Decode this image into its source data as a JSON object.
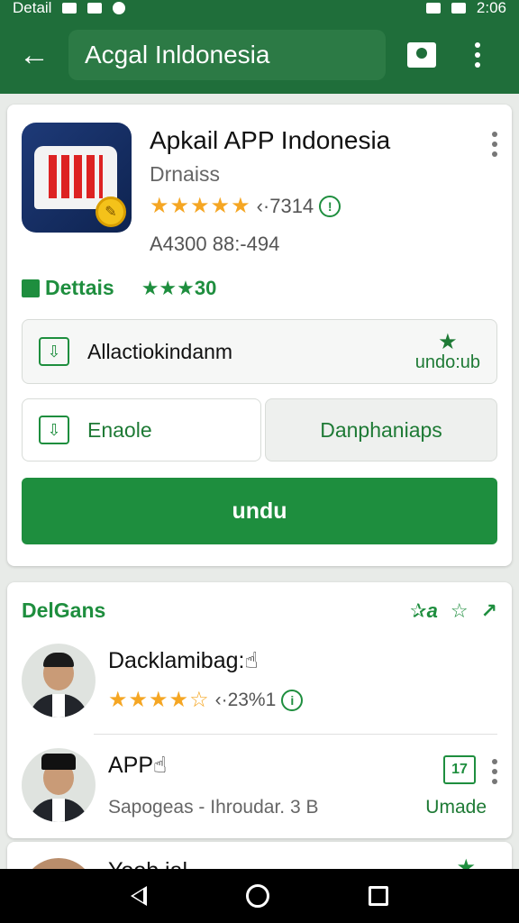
{
  "status_bar": {
    "left_text": "Detail",
    "time": "2:06"
  },
  "app_bar": {
    "back_icon": "arrow-left-icon",
    "search_text": "Acgal Inldonesia",
    "bookmark_icon": "bookmark-icon",
    "menu_icon": "more-vert-icon"
  },
  "app": {
    "title": "Apkail APP Indonesia",
    "developer": "Drnaiss",
    "stars": "★★★★★",
    "rating_count": "‹·7314",
    "info_glyph": "!",
    "meta": "A4300 88:-494"
  },
  "details": {
    "label": "Dettais",
    "rating": "★★★30"
  },
  "row_wide": {
    "label": "Allactiokindanm",
    "action_label": "undo:ub",
    "action_icon": "★"
  },
  "row_left": {
    "label": "Enaole"
  },
  "row_right": {
    "label": "Danphaniaps"
  },
  "primary_button": {
    "label": "undu"
  },
  "section": {
    "title": "DelGans",
    "action_1": "✰a",
    "action_2": "☆",
    "action_3": "↗"
  },
  "list": [
    {
      "title": "Dacklamibag:☝",
      "stars": "★★★★☆",
      "rating_count": "‹·23%1",
      "info_glyph": "i"
    },
    {
      "title": "APP☝",
      "subtitle": "Sapogeas - Ihroudar. 3 B",
      "action_box": "17",
      "action_label": "Umade"
    }
  ],
  "partial_item": {
    "title": "Yoob ial",
    "star": "★"
  },
  "colors": {
    "primary": "#1e8e3e",
    "appbar": "#1f6e3a",
    "star": "#f5a623"
  }
}
